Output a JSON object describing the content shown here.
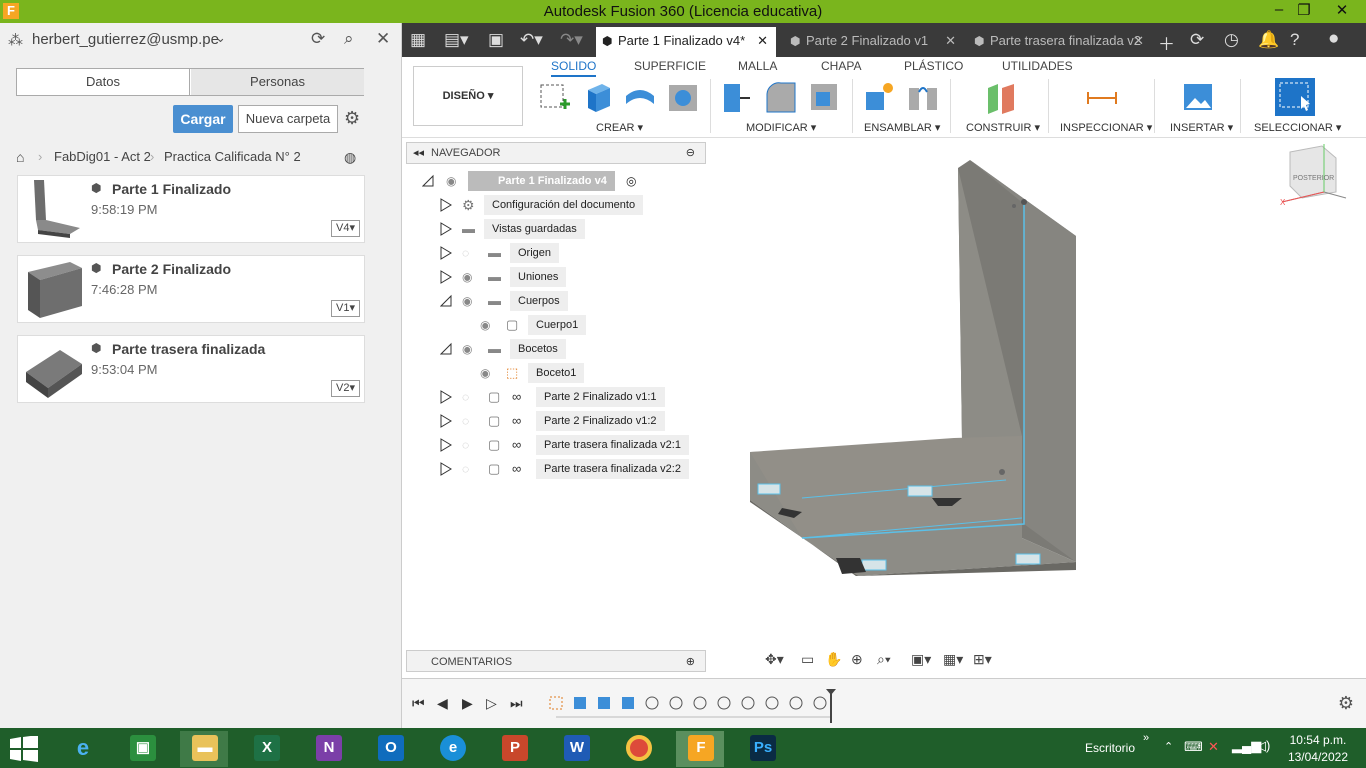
{
  "window": {
    "title": "Autodesk Fusion 360 (Licencia educativa)",
    "logo": "F"
  },
  "data_panel": {
    "user": "herbert_gutierrez@usmp.pe",
    "tabs": [
      "Datos",
      "Personas"
    ],
    "upload_label": "Cargar",
    "new_folder_label": "Nueva carpeta",
    "breadcrumb": [
      "FabDig01 - Act 2",
      "Practica Calificada N° 2"
    ],
    "files": [
      {
        "name": "Parte 1 Finalizado",
        "time": "9:58:19 PM",
        "version": "V4"
      },
      {
        "name": "Parte 2 Finalizado",
        "time": "7:46:28 PM",
        "version": "V1"
      },
      {
        "name": "Parte trasera finalizada",
        "time": "9:53:04 PM",
        "version": "V2"
      }
    ]
  },
  "doc_tabs": [
    {
      "label": "Parte 1 Finalizado v4*",
      "active": true
    },
    {
      "label": "Parte 2 Finalizado v1",
      "active": false
    },
    {
      "label": "Parte trasera finalizada v2",
      "active": false
    }
  ],
  "ribbon": {
    "workspace": "DISEÑO ▾",
    "tabs": [
      "SOLIDO",
      "SUPERFICIE",
      "MALLA",
      "CHAPA",
      "PLÁSTICO",
      "UTILIDADES"
    ],
    "groups": [
      "CREAR ▾",
      "MODIFICAR ▾",
      "ENSAMBLAR ▾",
      "CONSTRUIR ▾",
      "INSPECCIONAR ▾",
      "INSERTAR ▾",
      "SELECCIONAR ▾"
    ]
  },
  "navigator": {
    "title": "NAVEGADOR",
    "root": "Parte 1 Finalizado v4",
    "items": [
      "Configuración del documento",
      "Vistas guardadas",
      "Origen",
      "Uniones",
      "Cuerpos",
      "Cuerpo1",
      "Bocetos",
      "Boceto1",
      "Parte 2 Finalizado v1:1",
      "Parte 2 Finalizado v1:2",
      "Parte trasera finalizada v2:1",
      "Parte trasera finalizada v2:2"
    ]
  },
  "comments": {
    "title": "COMENTARIOS"
  },
  "viewcube": {
    "label": "POSTERIOR"
  },
  "taskbar": {
    "desktop": "Escritorio",
    "time": "10:54 p.m.",
    "date": "13/04/2022"
  },
  "colors": {
    "titlebar": "#7ab51d",
    "tabbar": "#3a3a3a",
    "accent": "#1e74c8",
    "taskbar": "#1f5e2a"
  }
}
